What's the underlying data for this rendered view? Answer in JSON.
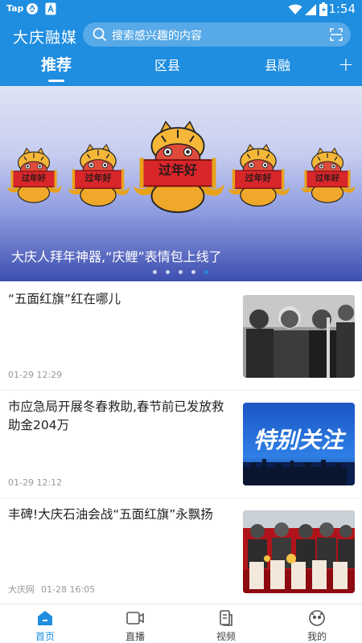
{
  "status_bar": {
    "app_label": "Tap",
    "time": "1:54"
  },
  "app_bar": {
    "logo": "大庆融媒",
    "search_placeholder": "搜索感兴趣的内容"
  },
  "tabs": [
    {
      "label": "推荐",
      "active": true
    },
    {
      "label": "区县",
      "active": false
    },
    {
      "label": "县融",
      "active": false
    }
  ],
  "banner": {
    "caption": "大庆人拜年神器,“庆鲤”表情包上线了",
    "mascot_text": "过年好",
    "dots_count": 5,
    "active_dot": 4
  },
  "news": [
    {
      "title": "“五面红旗”红在哪儿",
      "source": "",
      "time": "01-29 12:29"
    },
    {
      "title": "市应急局开展冬春救助,春节前已发放救助金204万",
      "source": "",
      "time": "01-29 12:12",
      "thumb_text": "特别关注"
    },
    {
      "title": "丰碑!大庆石油会战“五面红旗”永飘扬",
      "source": "大庆网",
      "time": "01-28 16:05"
    }
  ],
  "bottom_nav": [
    {
      "label": "首页",
      "icon": "home-icon",
      "active": true
    },
    {
      "label": "直播",
      "icon": "live-camera-icon",
      "active": false
    },
    {
      "label": "视频",
      "icon": "video-icon",
      "active": false
    },
    {
      "label": "我的",
      "icon": "profile-icon",
      "active": false
    }
  ],
  "colors": {
    "primary": "#1f8de0",
    "banner_red": "#d8262a"
  }
}
